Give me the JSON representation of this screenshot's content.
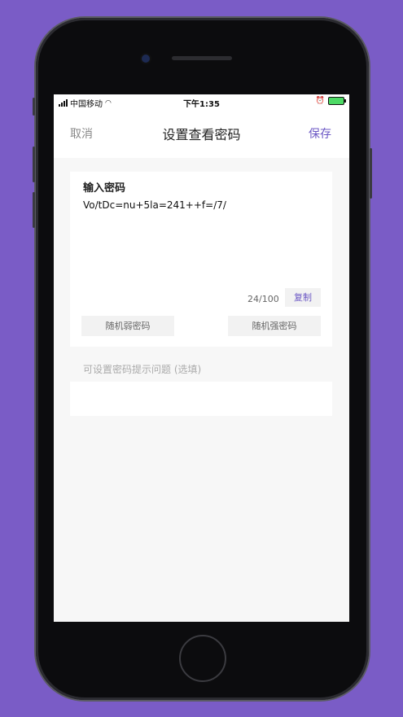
{
  "status_bar": {
    "carrier": "中国移动",
    "time": "下午1:35"
  },
  "navbar": {
    "cancel_label": "取消",
    "title": "设置查看密码",
    "save_label": "保存"
  },
  "password_card": {
    "label": "输入密码",
    "value": "Vo/tDc=nu+5la=241++f=/7/",
    "counter": "24/100",
    "copy_label": "复制",
    "weak_button": "随机弱密码",
    "strong_button": "随机强密码"
  },
  "hint": {
    "label": "可设置密码提示问题 (选填)",
    "value": ""
  },
  "colors": {
    "background": "#7a5cc6",
    "accent": "#6b57c4"
  }
}
